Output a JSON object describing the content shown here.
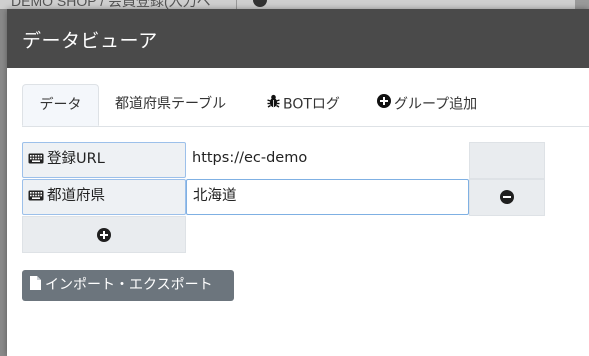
{
  "background": {
    "title": "DEMO SHOP / 会員登録(入力ペ"
  },
  "modal": {
    "title": "データビューア"
  },
  "tabs": [
    {
      "label": "データ",
      "icon": "",
      "active": true
    },
    {
      "label": "都道府県テーブル",
      "icon": "",
      "active": false
    },
    {
      "label": "BOTログ",
      "icon": "bug-icon",
      "active": false
    },
    {
      "label": "グループ追加",
      "icon": "plus-circle-icon",
      "active": false
    }
  ],
  "rows": [
    {
      "key": "登録URL",
      "key_icon": "keyboard-icon",
      "value": "https://ec-demo"
    },
    {
      "key": "都道府県",
      "key_icon": "keyboard-icon",
      "value": "北海道"
    }
  ],
  "import_export": {
    "label": "インポート・エクスポート",
    "icon": "file-icon"
  },
  "colors": {
    "header_bg": "#4a4a4a",
    "button_bg": "#6c757d",
    "focus_border": "#7fb0e3"
  }
}
